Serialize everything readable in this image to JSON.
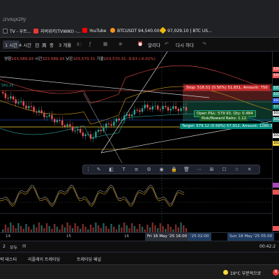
{
  "browser": {
    "url": "/2VXqXZPj/",
    "bookmarks": [
      "TV - 우트...",
      "지버위키(TVWIKI) -...",
      "YouTube",
      "BTCUSDT 94,540.00...",
      "97,029.10 | BTC US..."
    ]
  },
  "toolbar": {
    "items": [
      "1 시간",
      "4 시간",
      "日",
      "周",
      "중",
      "3 개월",
      "무료...",
      "알리다",
      "다시 하다"
    ]
  },
  "ohlc": {
    "open_label": "영험",
    "open": "103,589.93",
    "high_label": "시간",
    "high": "103,589.93",
    "low_label": "낮은",
    "low": "103,570.31",
    "close_label": "기울",
    "close": "103,570.31",
    "change": "-9.63 (-0.02%)",
    "left_value": "581.26"
  },
  "position": {
    "stop": "Stop: 516.51 (0.50%) 51,651, Amount: 750",
    "open": "Open P&L: 579.93, Qty: 0.484",
    "ratio": "Risk/Reward Ratio: 1.12",
    "target": "Target: 579.12 (0.56%) 57,912, Amount: 1280.3"
  },
  "price_scale": [
    "104",
    "104",
    "103",
    "103",
    "103",
    "103",
    "102",
    "102",
    "102",
    "102"
  ],
  "time_axis": {
    "ticks": [
      "14",
      "15",
      "16",
      "18"
    ],
    "cursor_time": "Fri 16 May '25   16:00",
    "range_end_label": "'25  02:00",
    "right_box": "Sun 18 May '25   05:00",
    "clock": "00:42:2"
  },
  "bottom_panel": {
    "row1": [
      "2",
      "모두"
    ],
    "row2": [
      "략 테스터",
      "리플레이 트레이딩",
      "트레이딩 패널"
    ]
  },
  "taskbar": {
    "weather": "19°C  부분적으로",
    "badge": "N"
  },
  "colors": {
    "bull": "#26a69a",
    "bear": "#ef5350",
    "stop_zone": "#5a1e1e",
    "target_zone": "#0d3b2e",
    "accent": "#2962ff"
  },
  "chart_data": {
    "type": "candlestick",
    "note_series": [
      "price",
      "bollinger",
      "rsi",
      "volume"
    ]
  }
}
